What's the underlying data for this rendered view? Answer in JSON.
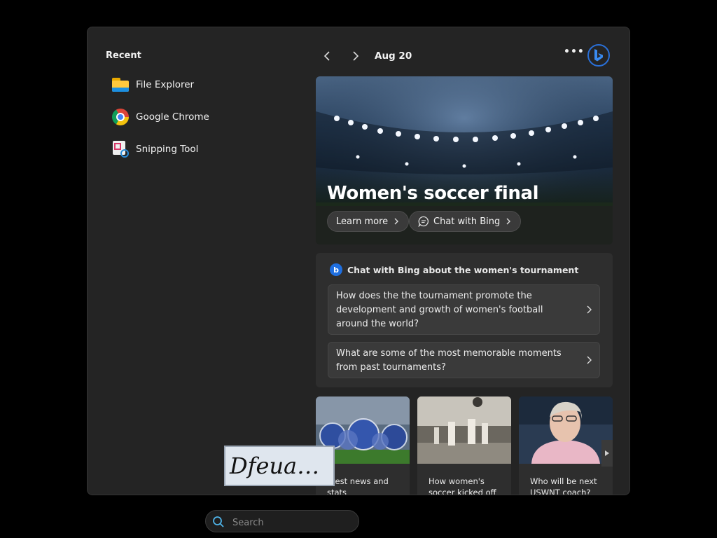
{
  "recent": {
    "title": "Recent",
    "items": [
      {
        "label": "File Explorer",
        "icon": "folder-icon"
      },
      {
        "label": "Google Chrome",
        "icon": "chrome-icon"
      },
      {
        "label": "Snipping Tool",
        "icon": "snipping-tool-icon"
      }
    ]
  },
  "header": {
    "date": "Aug 20",
    "more_label": "•••"
  },
  "hero": {
    "title": "Women's soccer final",
    "learn_more": "Learn more",
    "chat_with_bing": "Chat with Bing"
  },
  "bing_card": {
    "heading": "Chat with Bing about the women's tournament",
    "logo_letter": "b",
    "questions": [
      "How does the the tournament promote the development and growth of women's football around the world?",
      "What are some of the most memorable moments from past tournaments?"
    ]
  },
  "news": [
    {
      "caption": "atest news and stats",
      "image": "soccer-balls-image"
    },
    {
      "caption": "How women's soccer kicked off",
      "image": "vintage-soccer-image"
    },
    {
      "caption": "Who will be next USWNT coach?",
      "image": "coach-portrait-image"
    }
  ],
  "handwriting": {
    "text": "Dfeua…"
  },
  "search": {
    "placeholder": "Search",
    "value": ""
  },
  "colors": {
    "accent": "#2a6fd6",
    "panel_bg": "#242424",
    "card_bg": "#2e2e2e"
  }
}
